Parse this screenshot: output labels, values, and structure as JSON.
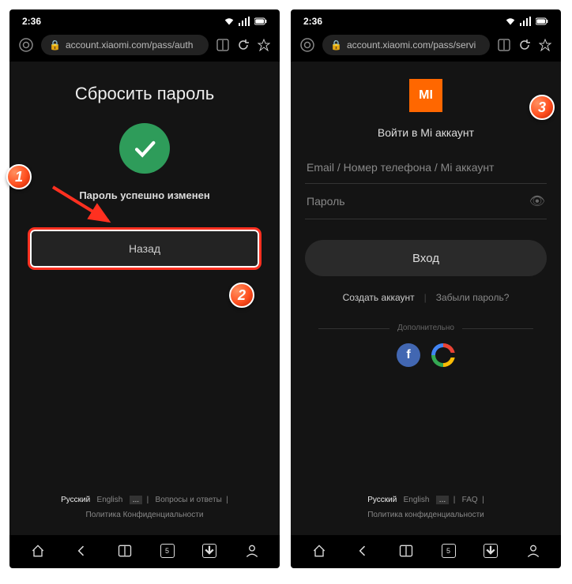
{
  "left": {
    "time": "2:36",
    "url": "account.xiaomi.com/pass/auth",
    "title": "Сбросить пароль",
    "success": "Пароль успешно изменен",
    "back": "Назад",
    "footer": {
      "ru": "Русский",
      "en": "English",
      "more": "...",
      "faq": "Вопросы и ответы",
      "privacy": "Политика Конфиденциальности"
    }
  },
  "right": {
    "time": "2:36",
    "url": "account.xiaomi.com/pass/servi",
    "logo": "MI",
    "title": "Войти в Mi аккаунт",
    "email_ph": "Email / Номер телефона / Mi аккаунт",
    "pass_ph": "Пароль",
    "login": "Вход",
    "create": "Создать аккаунт",
    "forgot": "Забыли пароль?",
    "extra": "Дополнительно",
    "footer": {
      "ru": "Русский",
      "en": "English",
      "more": "...",
      "faq": "FAQ",
      "privacy": "Политика конфиденциальности"
    }
  },
  "badges": {
    "b1": "1",
    "b2": "2",
    "b3": "3"
  },
  "nav": {
    "tabs": "5"
  }
}
